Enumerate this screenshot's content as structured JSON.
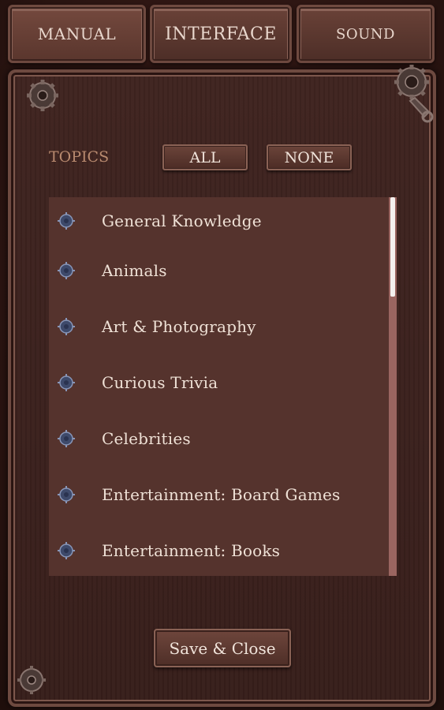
{
  "tabs": [
    {
      "label": "MANUAL",
      "active": true
    },
    {
      "label": "INTERFACE",
      "active": false
    },
    {
      "label": "SOUND",
      "active": false
    }
  ],
  "topics": {
    "label": "TOPICS",
    "all_label": "ALL",
    "none_label": "NONE",
    "items": [
      {
        "label": "General Knowledge",
        "icon": "gear-bullet-icon"
      },
      {
        "label": "Animals",
        "icon": "gear-bullet-icon"
      },
      {
        "label": "Art & Photography",
        "icon": "gear-bullet-icon"
      },
      {
        "label": "Curious Trivia",
        "icon": "gear-bullet-icon"
      },
      {
        "label": "Celebrities",
        "icon": "gear-bullet-icon"
      },
      {
        "label": "Entertainment: Board Games",
        "icon": "gear-bullet-icon"
      },
      {
        "label": "Entertainment: Books",
        "icon": "gear-bullet-icon"
      }
    ]
  },
  "footer": {
    "save_label": "Save & Close"
  },
  "colors": {
    "panel": "#3f2420",
    "list_bg": "#55332d",
    "text": "#efe1d6",
    "topics_label": "#b98a6f",
    "scroll_track": "#9a6560",
    "scroll_thumb": "#f4f0ee"
  }
}
